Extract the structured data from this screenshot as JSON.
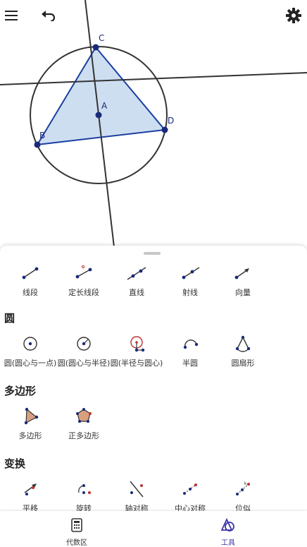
{
  "toolbar": {
    "menu_icon": "menu-icon",
    "undo_icon": "undo-icon",
    "settings_icon": "gear-icon"
  },
  "graphics": {
    "points": {
      "A": "A",
      "B": "B",
      "C": "C",
      "D": "D"
    }
  },
  "tools": {
    "lines": [
      {
        "label": "线段",
        "icon": "segment-icon"
      },
      {
        "label": "定长线段",
        "icon": "segment-fixed-length-icon"
      },
      {
        "label": "直线",
        "icon": "line-icon"
      },
      {
        "label": "射线",
        "icon": "ray-icon"
      },
      {
        "label": "向量",
        "icon": "vector-icon"
      }
    ],
    "circle_title": "圆",
    "circles": [
      {
        "label": "圆(圆心与一点)",
        "icon": "circle-center-point-icon"
      },
      {
        "label": "圆(圆心与半径)",
        "icon": "circle-center-radius-icon"
      },
      {
        "label": "圆(半径与圆心)",
        "icon": "compass-icon"
      },
      {
        "label": "半圆",
        "icon": "semicircle-icon"
      },
      {
        "label": "圆扇形",
        "icon": "circular-sector-icon"
      }
    ],
    "polygon_title": "多边形",
    "polygons": [
      {
        "label": "多边形",
        "icon": "polygon-icon"
      },
      {
        "label": "正多边形",
        "icon": "regular-polygon-icon"
      }
    ],
    "transform_title": "变换",
    "transforms": [
      {
        "label": "平移",
        "icon": "translate-icon"
      },
      {
        "label": "旋转",
        "icon": "rotate-icon"
      },
      {
        "label": "轴对称",
        "icon": "reflect-line-icon"
      },
      {
        "label": "中心对称",
        "icon": "reflect-point-icon"
      },
      {
        "label": "位似",
        "icon": "dilate-icon"
      }
    ]
  },
  "nav": {
    "algebra_label": "代数区",
    "tools_label": "工具",
    "active_color": "#3d35a8"
  }
}
